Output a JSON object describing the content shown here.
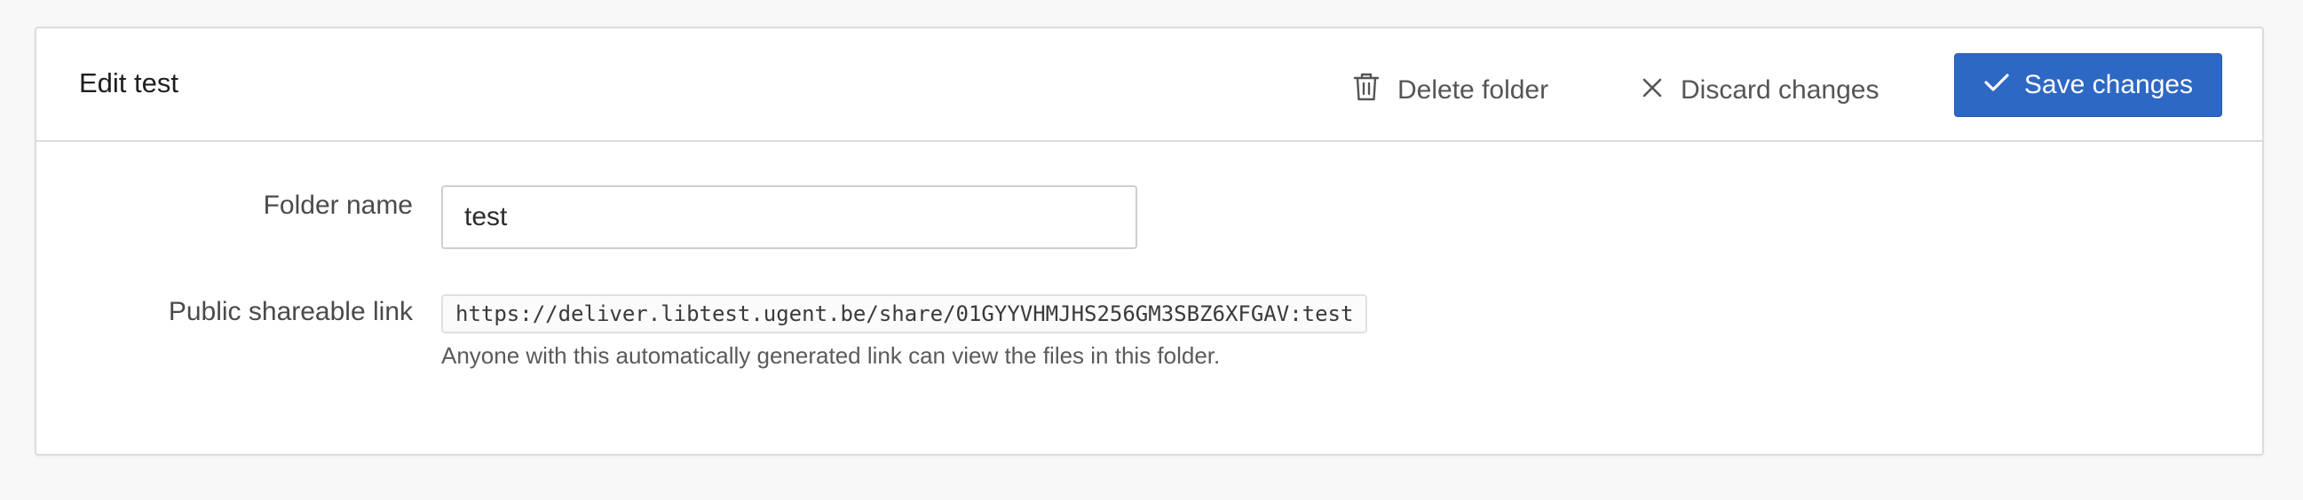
{
  "header": {
    "title": "Edit test",
    "delete_label": "Delete folder",
    "discard_label": "Discard changes",
    "save_label": "Save changes"
  },
  "form": {
    "folder_name_label": "Folder name",
    "folder_name_value": "test",
    "link_label": "Public shareable link",
    "link_value": "https://deliver.libtest.ugent.be/share/01GYYVHMJHS256GM3SBZ6XFGAV:test",
    "link_help": "Anyone with this automatically generated link can view the files in this folder."
  },
  "icons": {
    "delete": "trash-icon",
    "discard": "close-icon",
    "save": "check-icon"
  },
  "colors": {
    "primary": "#2d68c4",
    "page_background": "#f8f8f8",
    "card_background": "#ffffff",
    "border": "#dcdcdc"
  }
}
